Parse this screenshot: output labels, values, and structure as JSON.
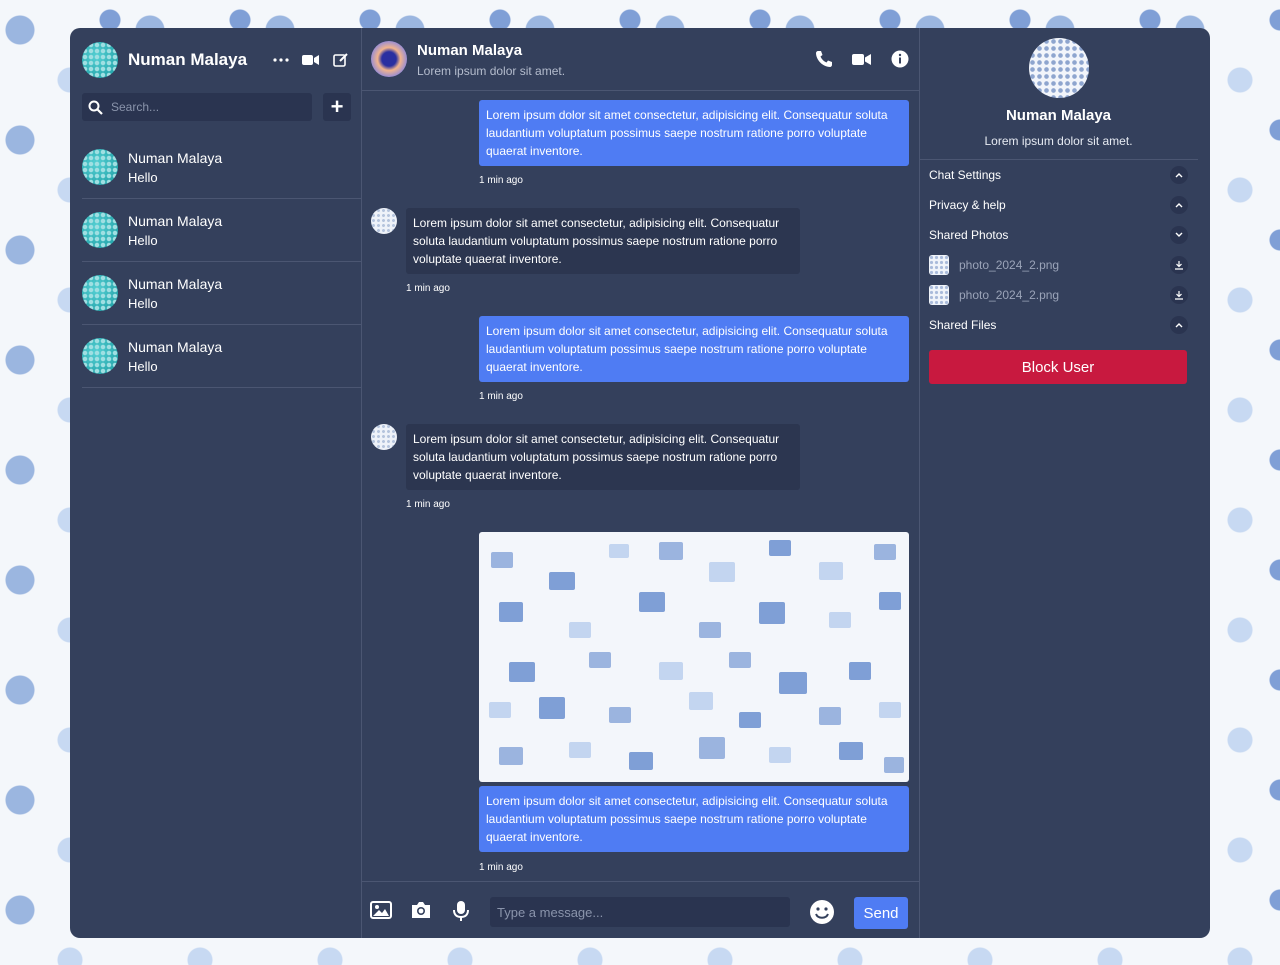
{
  "sidebar": {
    "user_name": "Numan Malaya",
    "search_placeholder": "Search...",
    "contacts": [
      {
        "name": "Numan Malaya",
        "last_message": "Hello"
      },
      {
        "name": "Numan Malaya",
        "last_message": "Hello"
      },
      {
        "name": "Numan Malaya",
        "last_message": "Hello"
      },
      {
        "name": "Numan Malaya",
        "last_message": "Hello"
      }
    ],
    "icons": [
      "more-icon",
      "video-icon",
      "edit-icon",
      "search-icon",
      "plus-icon"
    ]
  },
  "chat": {
    "header": {
      "title": "Numan Malaya",
      "subtitle": "Lorem ipsum dolor sit amet."
    },
    "messages": [
      {
        "direction": "out",
        "text": "Lorem ipsum dolor sit amet consectetur, adipisicing elit. Consequatur soluta laudantium voluptatum possimus saepe nostrum ratione porro voluptate quaerat inventore.",
        "time": "1 min ago"
      },
      {
        "direction": "in",
        "text": "Lorem ipsum dolor sit amet consectetur, adipisicing elit. Consequatur soluta laudantium voluptatum possimus saepe nostrum ratione porro voluptate quaerat inventore.",
        "time": "1 min ago"
      },
      {
        "direction": "out",
        "text": "Lorem ipsum dolor sit amet consectetur, adipisicing elit. Consequatur soluta laudantium voluptatum possimus saepe nostrum ratione porro voluptate quaerat inventore.",
        "time": "1 min ago"
      },
      {
        "direction": "in",
        "text": "Lorem ipsum dolor sit amet consectetur, adipisicing elit. Consequatur soluta laudantium voluptatum possimus saepe nostrum ratione porro voluptate quaerat inventore.",
        "time": "1 min ago"
      },
      {
        "direction": "out",
        "text": "Lorem ipsum dolor sit amet consectetur, adipisicing elit. Consequatur soluta laudantium voluptatum possimus saepe nostrum ratione porro voluptate quaerat inventore.",
        "time": "1 min ago"
      }
    ],
    "composer": {
      "placeholder": "Type a message...",
      "send_label": "Send"
    }
  },
  "info_panel": {
    "name": "Numan Malaya",
    "subtitle": "Lorem ipsum dolor sit amet.",
    "sections": {
      "chat_settings": "Chat Settings",
      "privacy": "Privacy & help",
      "shared_photos": "Shared Photos",
      "shared_files": "Shared Files"
    },
    "photos": [
      "photo_2024_2.png",
      "photo_2024_2.png"
    ],
    "block_label": "Block User"
  },
  "colors": {
    "app_bg": "#34405c",
    "outgoing_bubble": "#4f7cf3",
    "incoming_bubble": "#2c3650",
    "block_button": "#c8193f"
  }
}
